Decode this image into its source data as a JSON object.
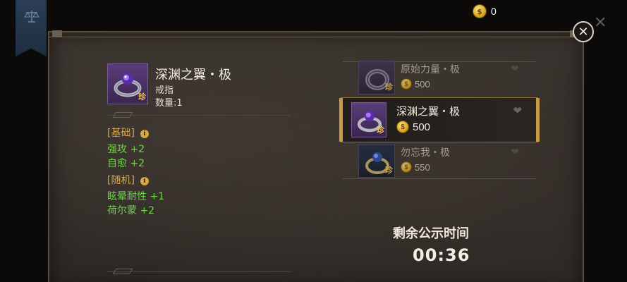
{
  "top_bar": {
    "gold_amount": "0"
  },
  "detail": {
    "name": "深渊之翼・极",
    "type": "戒指",
    "quantity": "数量:1",
    "rarity_badge": "珍",
    "base_section": {
      "label": "[基础]",
      "stats": [
        "强攻 +2",
        "自愈 +2"
      ]
    },
    "random_section": {
      "label": "[随机]",
      "stats": [
        "眩晕耐性 +1",
        "荷尔蒙 +2"
      ]
    }
  },
  "listings": [
    {
      "name": "原始力量・极",
      "price": "500",
      "rarity": "珍",
      "selected": false
    },
    {
      "name": "深渊之翼・极",
      "price": "500",
      "rarity": "珍",
      "selected": true
    },
    {
      "name": "勿忘我・极",
      "price": "550",
      "rarity": "珍",
      "selected": false
    }
  ],
  "timer": {
    "label": "剩余公示时间",
    "value": "00:36"
  },
  "icons": {
    "banner": "scales-icon",
    "currency": "gold-coin-icon",
    "close": "close-icon",
    "favorite": "heart-icon",
    "info": "info-icon"
  },
  "colors": {
    "stat_green": "#6ed44a",
    "section_gold": "#d8a652",
    "selection_border": "#c89a45"
  }
}
